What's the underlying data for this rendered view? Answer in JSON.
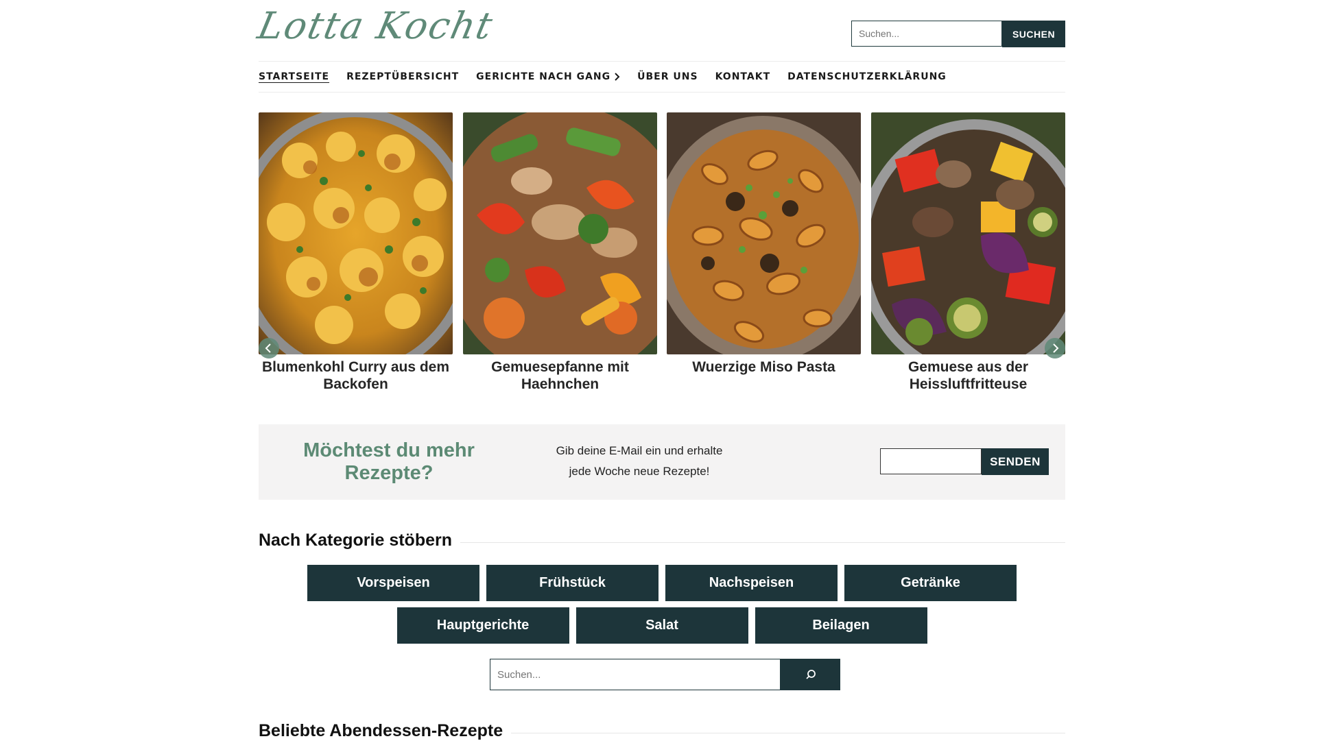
{
  "header": {
    "logo_text": "Lotta Kocht",
    "search_placeholder": "Suchen...",
    "search_button": "SUCHEN"
  },
  "nav": {
    "items": [
      {
        "label": "STARTSEITE"
      },
      {
        "label": "REZEPTÜBERSICHT"
      },
      {
        "label": "GERICHTE NACH GANG"
      },
      {
        "label": "ÜBER UNS"
      },
      {
        "label": "KONTAKT"
      },
      {
        "label": "DATENSCHUTZERKLÄRUNG"
      }
    ]
  },
  "slider": {
    "slides": [
      {
        "title": "Blumenkohl Curry aus dem Backofen"
      },
      {
        "title": "Gemuesepfanne mit Haehnchen"
      },
      {
        "title": "Wuerzige Miso Pasta"
      },
      {
        "title": "Gemuese aus der Heissluftfritteuse"
      }
    ],
    "prev_icon": "chevron-left-icon",
    "next_icon": "chevron-right-icon"
  },
  "newsletter": {
    "title": "Möchtest du mehr Rezepte?",
    "text": "Gib deine E-Mail ein und erhalte jede Woche neue Rezepte!",
    "email_value": "",
    "button": "SENDEN"
  },
  "categories": {
    "heading": "Nach Kategorie stöbern",
    "row1": [
      "Vorspeisen",
      "Frühstück",
      "Nachspeisen",
      "Getränke"
    ],
    "row2": [
      "Hauptgerichte",
      "Salat",
      "Beilagen"
    ],
    "search_placeholder": "Suchen...",
    "search_icon": "search-icon"
  },
  "popular": {
    "heading": "Beliebte Abendessen-Rezepte"
  },
  "colors": {
    "dark_teal": "#1d353a",
    "accent_green": "#5c8a74",
    "newsletter_bg": "#f4f3f3"
  }
}
